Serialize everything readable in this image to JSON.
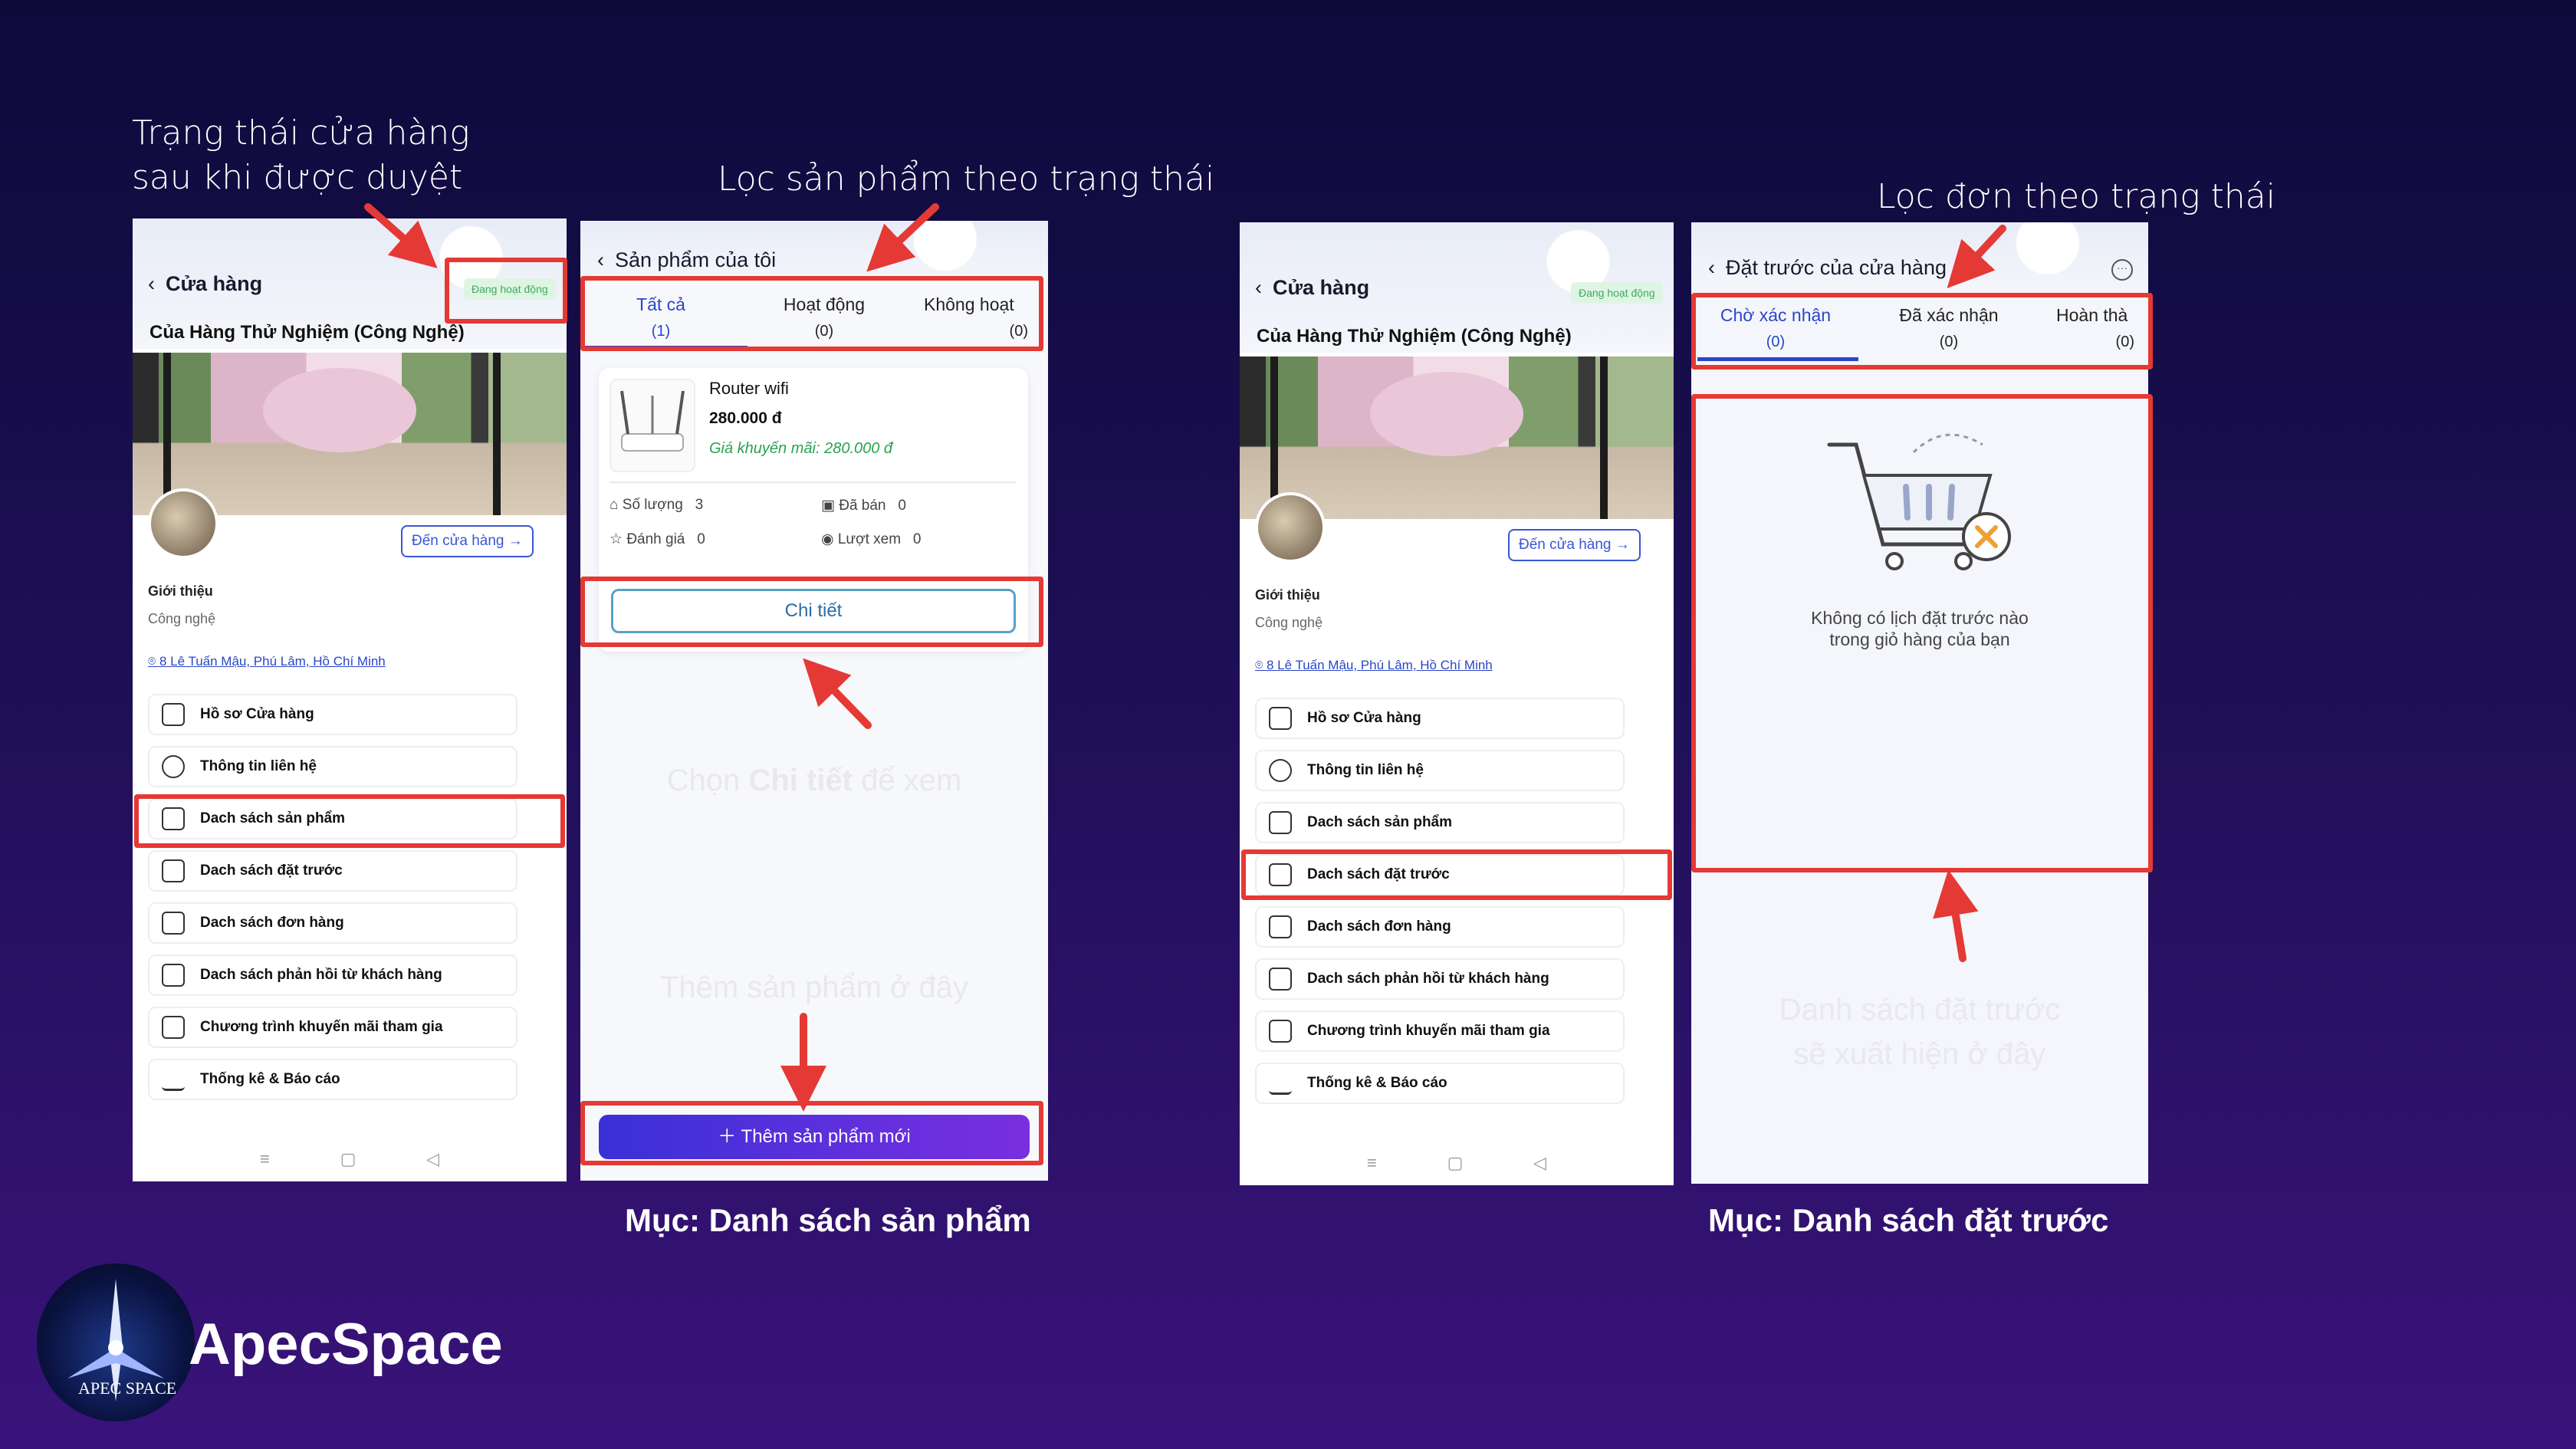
{
  "annotations": {
    "store_status": "Trạng thái cửa hàng\nsau khi được duyệt",
    "filter_products": "Lọc sản phẩm theo trạng thái",
    "filter_orders": "Lọc đơn theo trạng thái",
    "choose_detail_prefix": "Chọn ",
    "choose_detail_bold": "Chi tiết",
    "choose_detail_suffix": " để xem",
    "add_product_here": "Thêm sản phẩm ở đây",
    "preorder_list_appear": "Danh sách đặt trước\nsẽ xuất hiện ở đây"
  },
  "captions": {
    "products": "Mục: Danh sách sản phẩm",
    "preorders": "Mục: Danh sách đặt trước"
  },
  "store_screen": {
    "back_title": "Cửa hàng",
    "status": "Đang hoạt động",
    "store_name": "Của Hàng Thử Nghiệm (Công Nghệ)",
    "go_store": "Đến cửa hàng",
    "intro_label": "Giới thiệu",
    "intro_value": "Công nghệ",
    "address": "8 Lê Tuấn Mậu, Phú Lâm, Hồ Chí Minh",
    "menu": [
      {
        "label": "Hồ sơ Cửa hàng",
        "icon": "store-icon"
      },
      {
        "label": "Thông tin liên hệ",
        "icon": "headset-icon"
      },
      {
        "label": "Dach sách sản phẩm",
        "icon": "product-icon"
      },
      {
        "label": "Dach sách đặt trước",
        "icon": "preorder-icon"
      },
      {
        "label": "Dach sách đơn hàng",
        "icon": "order-icon"
      },
      {
        "label": "Dach sách phản hồi từ khách hàng",
        "icon": "chat-icon"
      },
      {
        "label": "Chương trình khuyến mãi tham gia",
        "icon": "ticket-icon"
      },
      {
        "label": "Thống kê & Báo cáo",
        "icon": "chart-icon"
      }
    ]
  },
  "products_screen": {
    "title": "Sản phẩm của tôi",
    "tabs": [
      {
        "label": "Tất cả",
        "count": "(1)"
      },
      {
        "label": "Hoạt động",
        "count": "(0)"
      },
      {
        "label": "Không hoạt",
        "count": "(0)"
      }
    ],
    "product": {
      "name": "Router wifi",
      "price": "280.000 đ",
      "promo": "Giá khuyến mãi: 280.000 đ",
      "qty_label": "Số lượng",
      "qty": "3",
      "sold_label": "Đã bán",
      "sold": "0",
      "rating_label": "Đánh giá",
      "rating": "0",
      "views_label": "Lượt xem",
      "views": "0"
    },
    "detail_btn": "Chi tiết",
    "add_btn": "Thêm sản phẩm mới"
  },
  "preorder_screen": {
    "title": "Đặt trước của cửa hàng",
    "tabs": [
      {
        "label": "Chờ xác nhận",
        "count": "(0)"
      },
      {
        "label": "Đã xác nhận",
        "count": "(0)"
      },
      {
        "label": "Hoàn thà",
        "count": "(0)"
      }
    ],
    "empty_text": "Không có lịch đặt trước nào\ntrong giỏ hàng của bạn"
  },
  "brand": {
    "name": "ApecSpace",
    "logo_text": "APEC SPACE"
  },
  "colors": {
    "accent": "#2a46c8",
    "highlight": "#e53935",
    "add_btn_start": "#3a30d8",
    "add_btn_end": "#7a2fe0"
  }
}
